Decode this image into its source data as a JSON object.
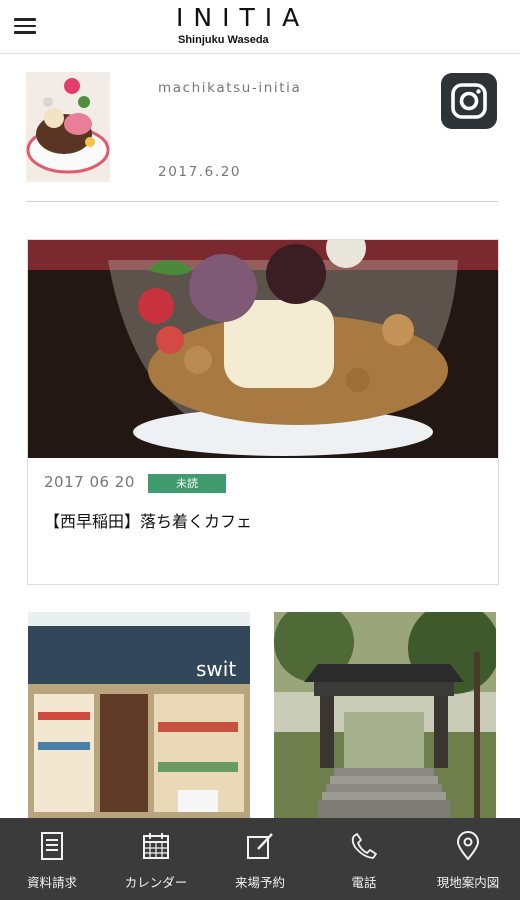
{
  "header": {
    "title": "INITIA",
    "subtitle": "Shinjuku Waseda"
  },
  "profile": {
    "account": "machikatsu-initia",
    "date": "2017.6.20"
  },
  "post": {
    "date": "2017 06 20",
    "badge": "未読",
    "title": "【西早稲田】落ち着くカフェ"
  },
  "tiles": [
    {
      "photo": "storefront-photo",
      "sign_text": "swit"
    },
    {
      "photo": "temple-gate-photo"
    }
  ],
  "tabbar": {
    "tabs": [
      {
        "label": "資料請求",
        "icon": "document-icon"
      },
      {
        "label": "カレンダー",
        "icon": "calendar-icon"
      },
      {
        "label": "来場予約",
        "icon": "edit-icon"
      },
      {
        "label": "電話",
        "icon": "phone-icon"
      },
      {
        "label": "現地案内図",
        "icon": "map-pin-icon"
      }
    ]
  },
  "colors": {
    "tabbar_bg": "#3b3b3b",
    "badge_bg": "#3f9a6e",
    "instagram": "#2e3338"
  }
}
